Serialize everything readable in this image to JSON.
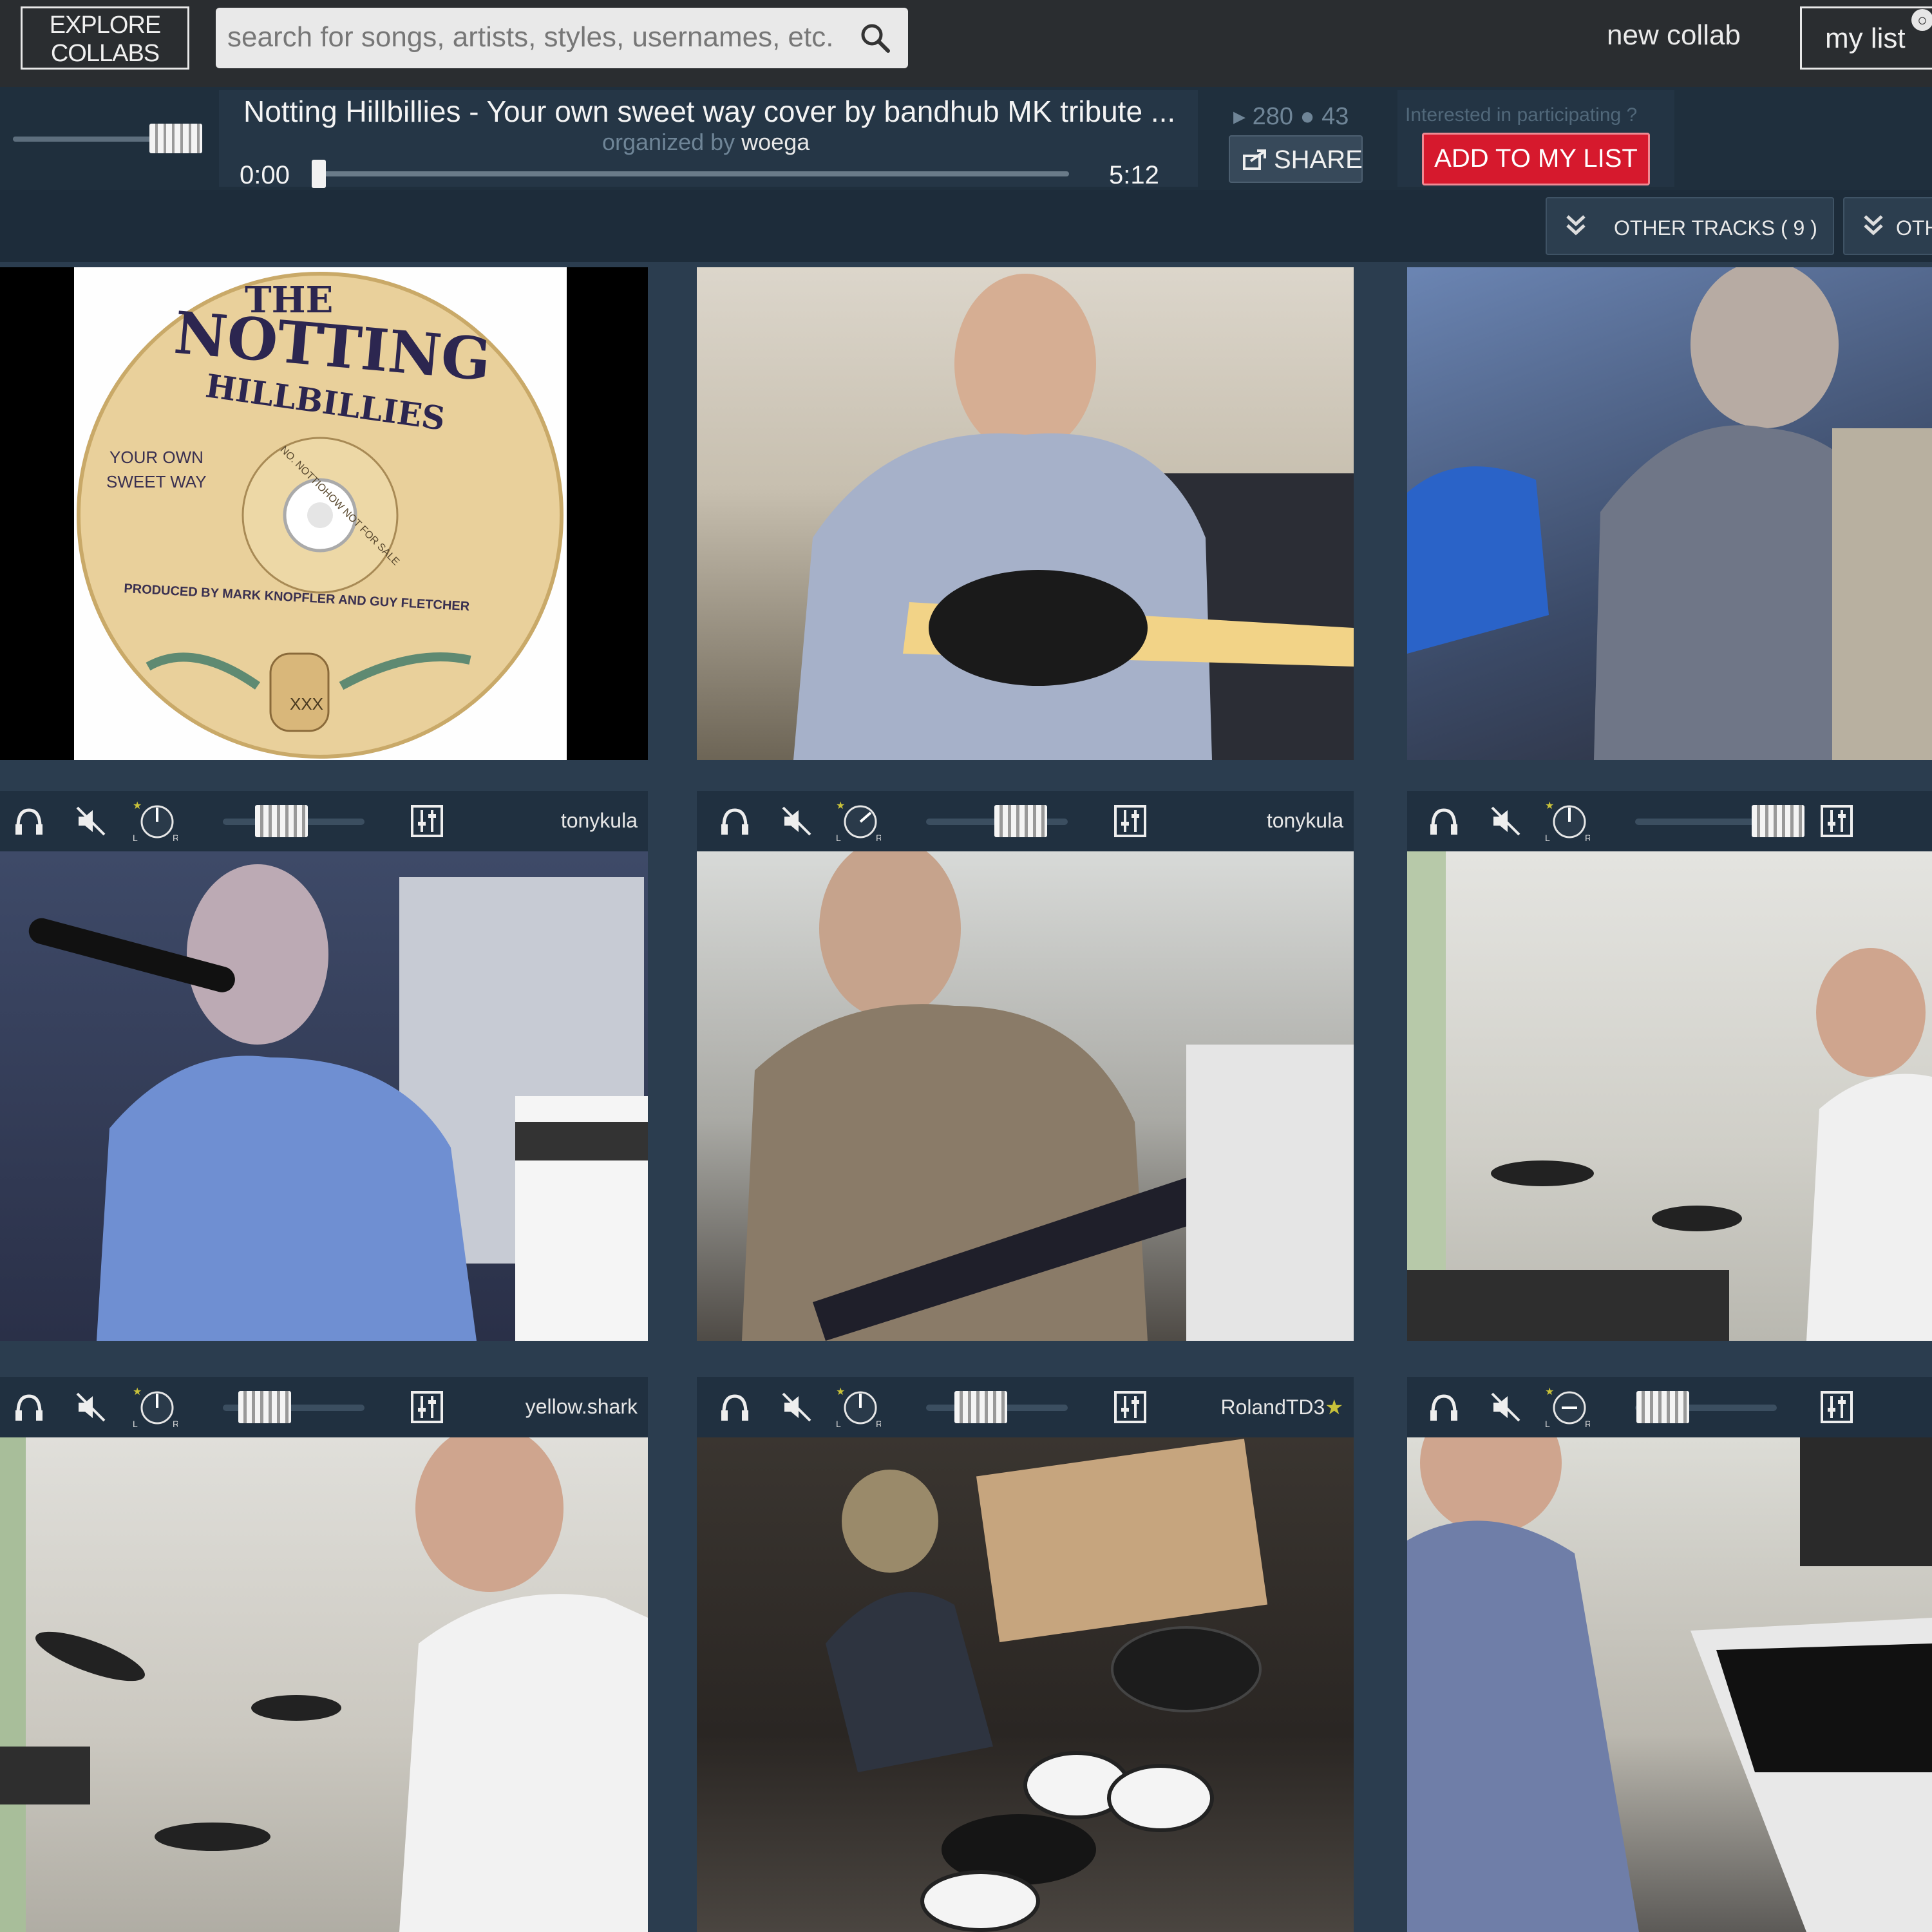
{
  "nav": {
    "explore_line1": "EXPLORE",
    "explore_line2": "COLLABS",
    "search_placeholder": "search for songs, artists, styles, usernames, etc.",
    "new_collab": "new collab",
    "my_list": "my list"
  },
  "player": {
    "title": "Notting Hillbillies - Your own sweet way cover by bandhub MK tribute ...",
    "organized_by_label": "organized by",
    "organizer": "woega",
    "time_current": "0:00",
    "time_total": "5:12",
    "plays": "280",
    "comments": "43",
    "share_label": "SHARE",
    "interested_text": "Interested in participating ?",
    "add_to_list_label": "ADD TO MY LIST"
  },
  "tracks_bar": {
    "other_tracks_label": "OTHER TRACKS ( 9 )",
    "other_label_2": "OTH"
  },
  "tiles": [
    {
      "kind": "album-art",
      "album_title_1": "THE",
      "album_title_2": "NOTTING",
      "album_title_3": "HILLBILLIES",
      "song_1": "YOUR OWN",
      "song_2": "SWEET WAY",
      "credit": "PRODUCED BY MARK KNOPFLER AND GUY FLETCHER",
      "ring_text": "NO. NOTTIOHOW  NOT FOR SALE",
      "jug": "XXX"
    },
    {
      "kind": "video",
      "scene": "bass-guitar-player"
    },
    {
      "kind": "video",
      "scene": "singer-at-keyboard"
    },
    {
      "kind": "video",
      "scene": "singer-with-mic"
    },
    {
      "kind": "video",
      "scene": "bass-player"
    },
    {
      "kind": "video",
      "scene": "drummer-e-kit"
    },
    {
      "kind": "video",
      "scene": "drummer-e-kit-2"
    },
    {
      "kind": "video",
      "scene": "drummer-top-view"
    },
    {
      "kind": "video",
      "scene": "keyboard-player"
    }
  ],
  "controls": [
    {
      "username": "tonykula",
      "starred": false
    },
    {
      "username": "tonykula",
      "starred": false
    },
    {
      "username": "",
      "starred": false
    },
    {
      "username": "yellow.shark",
      "starred": false
    },
    {
      "username": "RolandTD3",
      "starred": true
    },
    {
      "username": "",
      "starred": false
    }
  ],
  "colors": {
    "accent_red": "#d6192d",
    "panel_dark": "#1f2f3d",
    "page_bg": "#2b3d4f"
  }
}
